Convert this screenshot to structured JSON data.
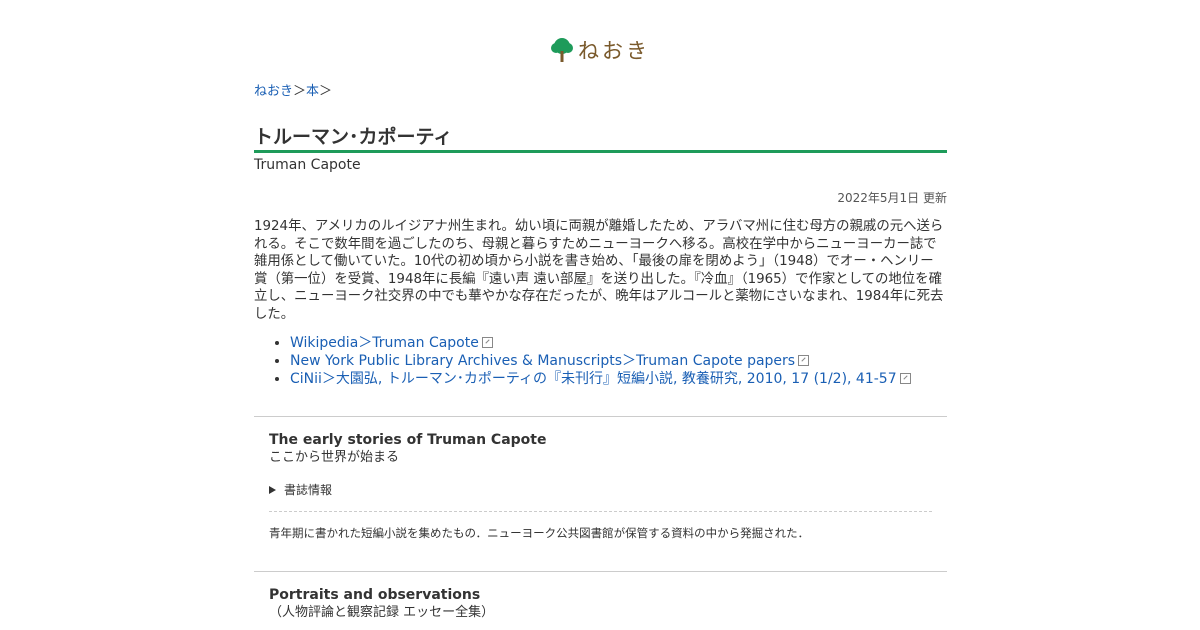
{
  "site": {
    "name": "ねおき",
    "brand_color": "#1e9b5a",
    "logo_icon": "tree-icon"
  },
  "breadcrumb": {
    "home": "ねおき",
    "separator": "＞",
    "section": "本"
  },
  "article": {
    "title": "トルーマン･カポーティ",
    "subtitle": "Truman Capote",
    "updated": "2022年5月1日 更新",
    "bio": "1924年、アメリカのルイジアナ州生まれ。幼い頃に両親が離婚したため、アラバマ州に住む母方の親戚の元へ送られる。そこで数年間を過ごしたのち、母親と暮らすためニューヨークへ移る。高校在学中からニューヨーカー誌で雑用係として働いていた。10代の初め頃から小説を書き始め、「最後の扉を閉めよう」（1948）でオー・ヘンリー賞（第一位）を受賞、1948年に長編『遠い声 遠い部屋』を送り出した。『冷血』（1965）で作家としての地位を確立し、ニューヨーク社交界の中でも華やかな存在だったが、晩年はアルコールと薬物にさいなまれ、1984年に死去した。"
  },
  "links": [
    {
      "label": "Wikipedia＞Truman Capote"
    },
    {
      "label": "New York Public Library Archives & Manuscripts＞Truman Capote papers"
    },
    {
      "label": "CiNii＞大園弘, トルーマン･カポーティの『未刊行』短編小説, 教養研究, 2010, 17 (1/2), 41-57"
    }
  ],
  "books": [
    {
      "title": "The early stories of Truman Capote",
      "subtitle": "ここから世界が始まる",
      "details_label": "書誌情報",
      "description": "青年期に書かれた短編小説を集めたもの．ニューヨーク公共図書館が保管する資料の中から発掘された．"
    },
    {
      "title": "Portraits and observations",
      "subtitle": "（人物評論と観察記録 エッセー全集）"
    }
  ]
}
